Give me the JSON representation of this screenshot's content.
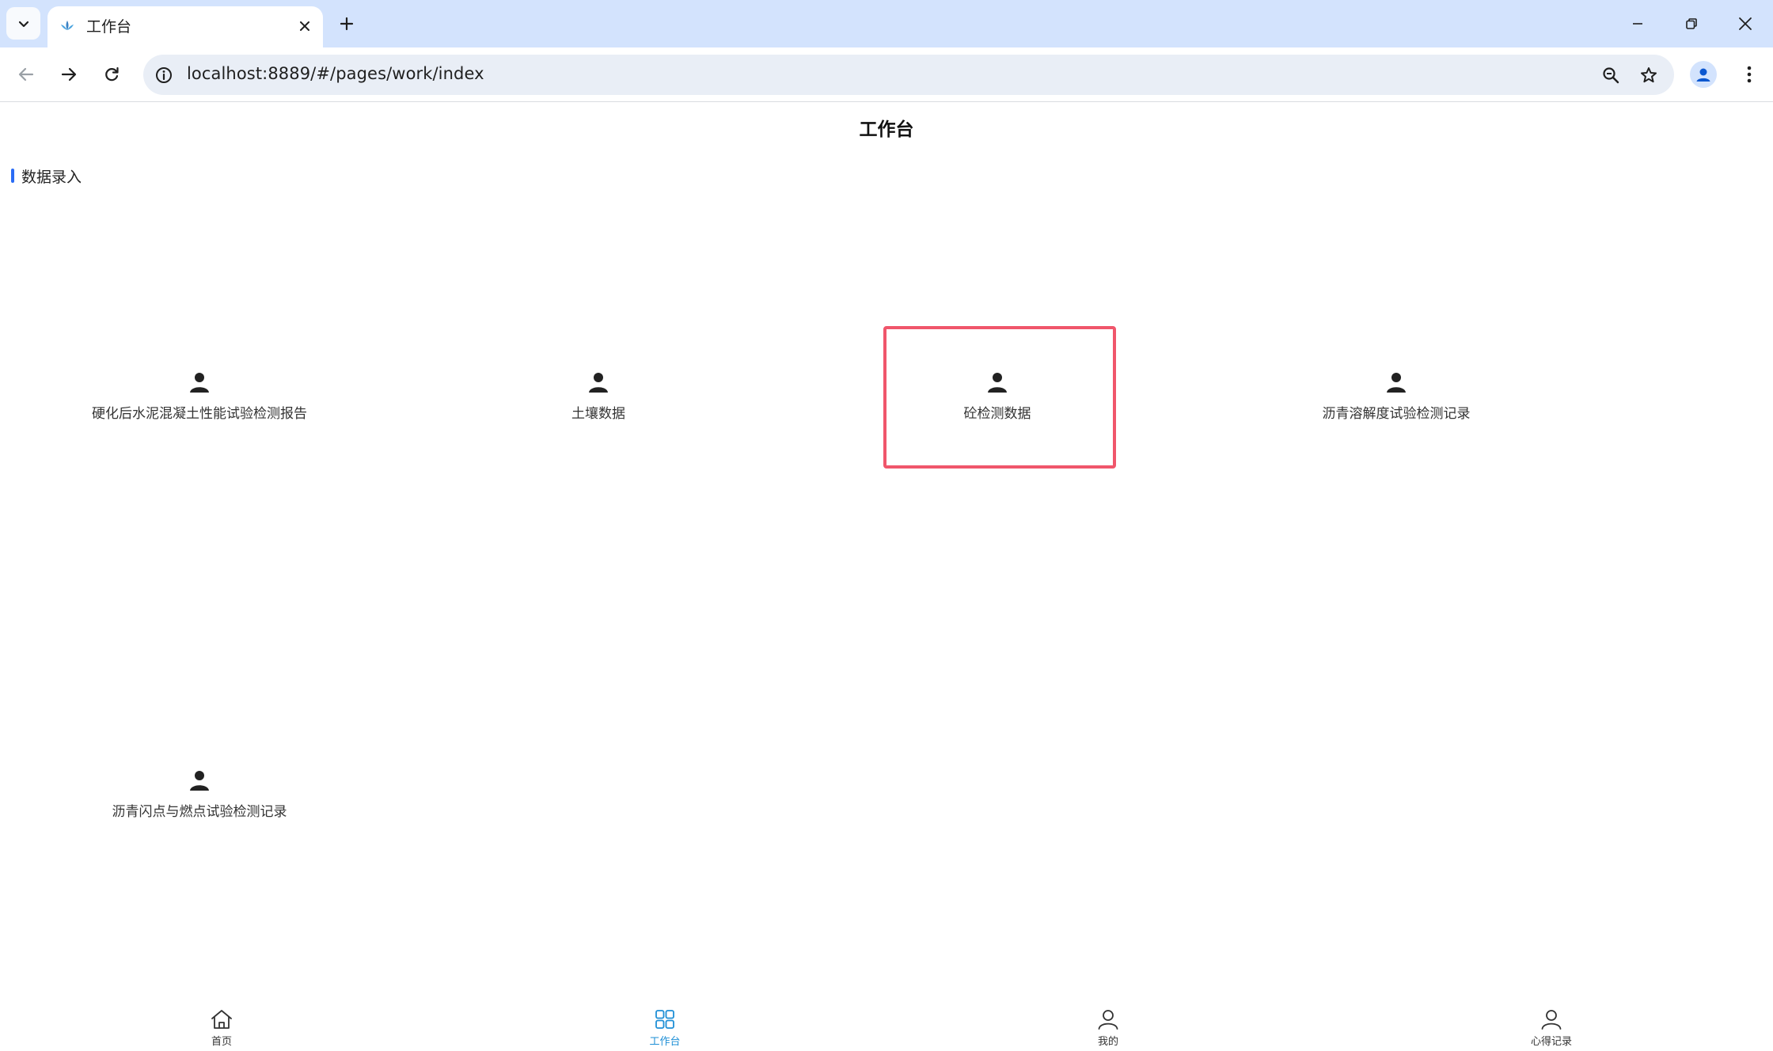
{
  "browser": {
    "tab_title": "工作台",
    "url": "localhost:8889/#/pages/work/index"
  },
  "page": {
    "title": "工作台",
    "section_title": "数据录入",
    "items": [
      {
        "label": "硬化后水泥混凝土性能试验检测报告",
        "icon": "person-icon"
      },
      {
        "label": "土壤数据",
        "icon": "person-icon"
      },
      {
        "label": "砼检测数据",
        "icon": "person-icon",
        "highlighted": true
      },
      {
        "label": "沥青溶解度试验检测记录",
        "icon": "person-icon"
      },
      {
        "label": "沥青闪点与燃点试验检测记录",
        "icon": "person-icon"
      }
    ],
    "highlight_color": "#f0566b",
    "section_accent_color": "#2a6cf5"
  },
  "bottom_nav": {
    "active_color": "#1e8fd6",
    "tabs": [
      {
        "label": "首页",
        "icon": "home-icon",
        "active": false
      },
      {
        "label": "工作台",
        "icon": "grid-icon",
        "active": true
      },
      {
        "label": "我的",
        "icon": "user-icon",
        "active": false
      },
      {
        "label": "心得记录",
        "icon": "user-icon",
        "active": false
      }
    ]
  }
}
